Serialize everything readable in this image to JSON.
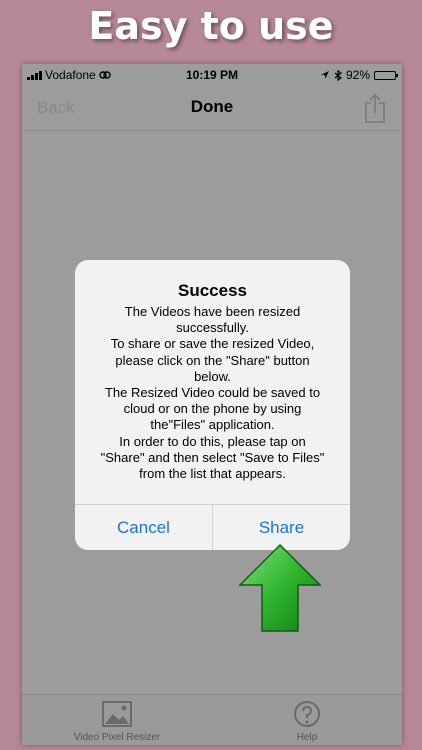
{
  "banner": {
    "text": "Easy to use"
  },
  "status_bar": {
    "carrier": "Vodafone",
    "time": "10:19 PM",
    "battery": "92%",
    "battery_level": 0.92
  },
  "nav": {
    "back_label": "Back",
    "title": "Done"
  },
  "alert": {
    "title": "Success",
    "lines": [
      "The Videos have been resized",
      "successfully.",
      "To share or save the resized Video,",
      "please click on the \"Share\" button",
      "below.",
      "The Resized Video could be saved to",
      "cloud or on the phone by using",
      "the\"Files\" application.",
      "In order to do this, please tap on",
      "\"Share\" and then select \"Save to Files\"",
      "from the list that appears."
    ],
    "cancel_label": "Cancel",
    "share_label": "Share"
  },
  "tabs": [
    {
      "label": "Video Pixel Resizer",
      "icon": "photo-icon"
    },
    {
      "label": "Help",
      "icon": "help-icon"
    }
  ],
  "colors": {
    "background": "#b7889a",
    "accent": "#1a73d8",
    "arrow": "#2fb52f"
  }
}
